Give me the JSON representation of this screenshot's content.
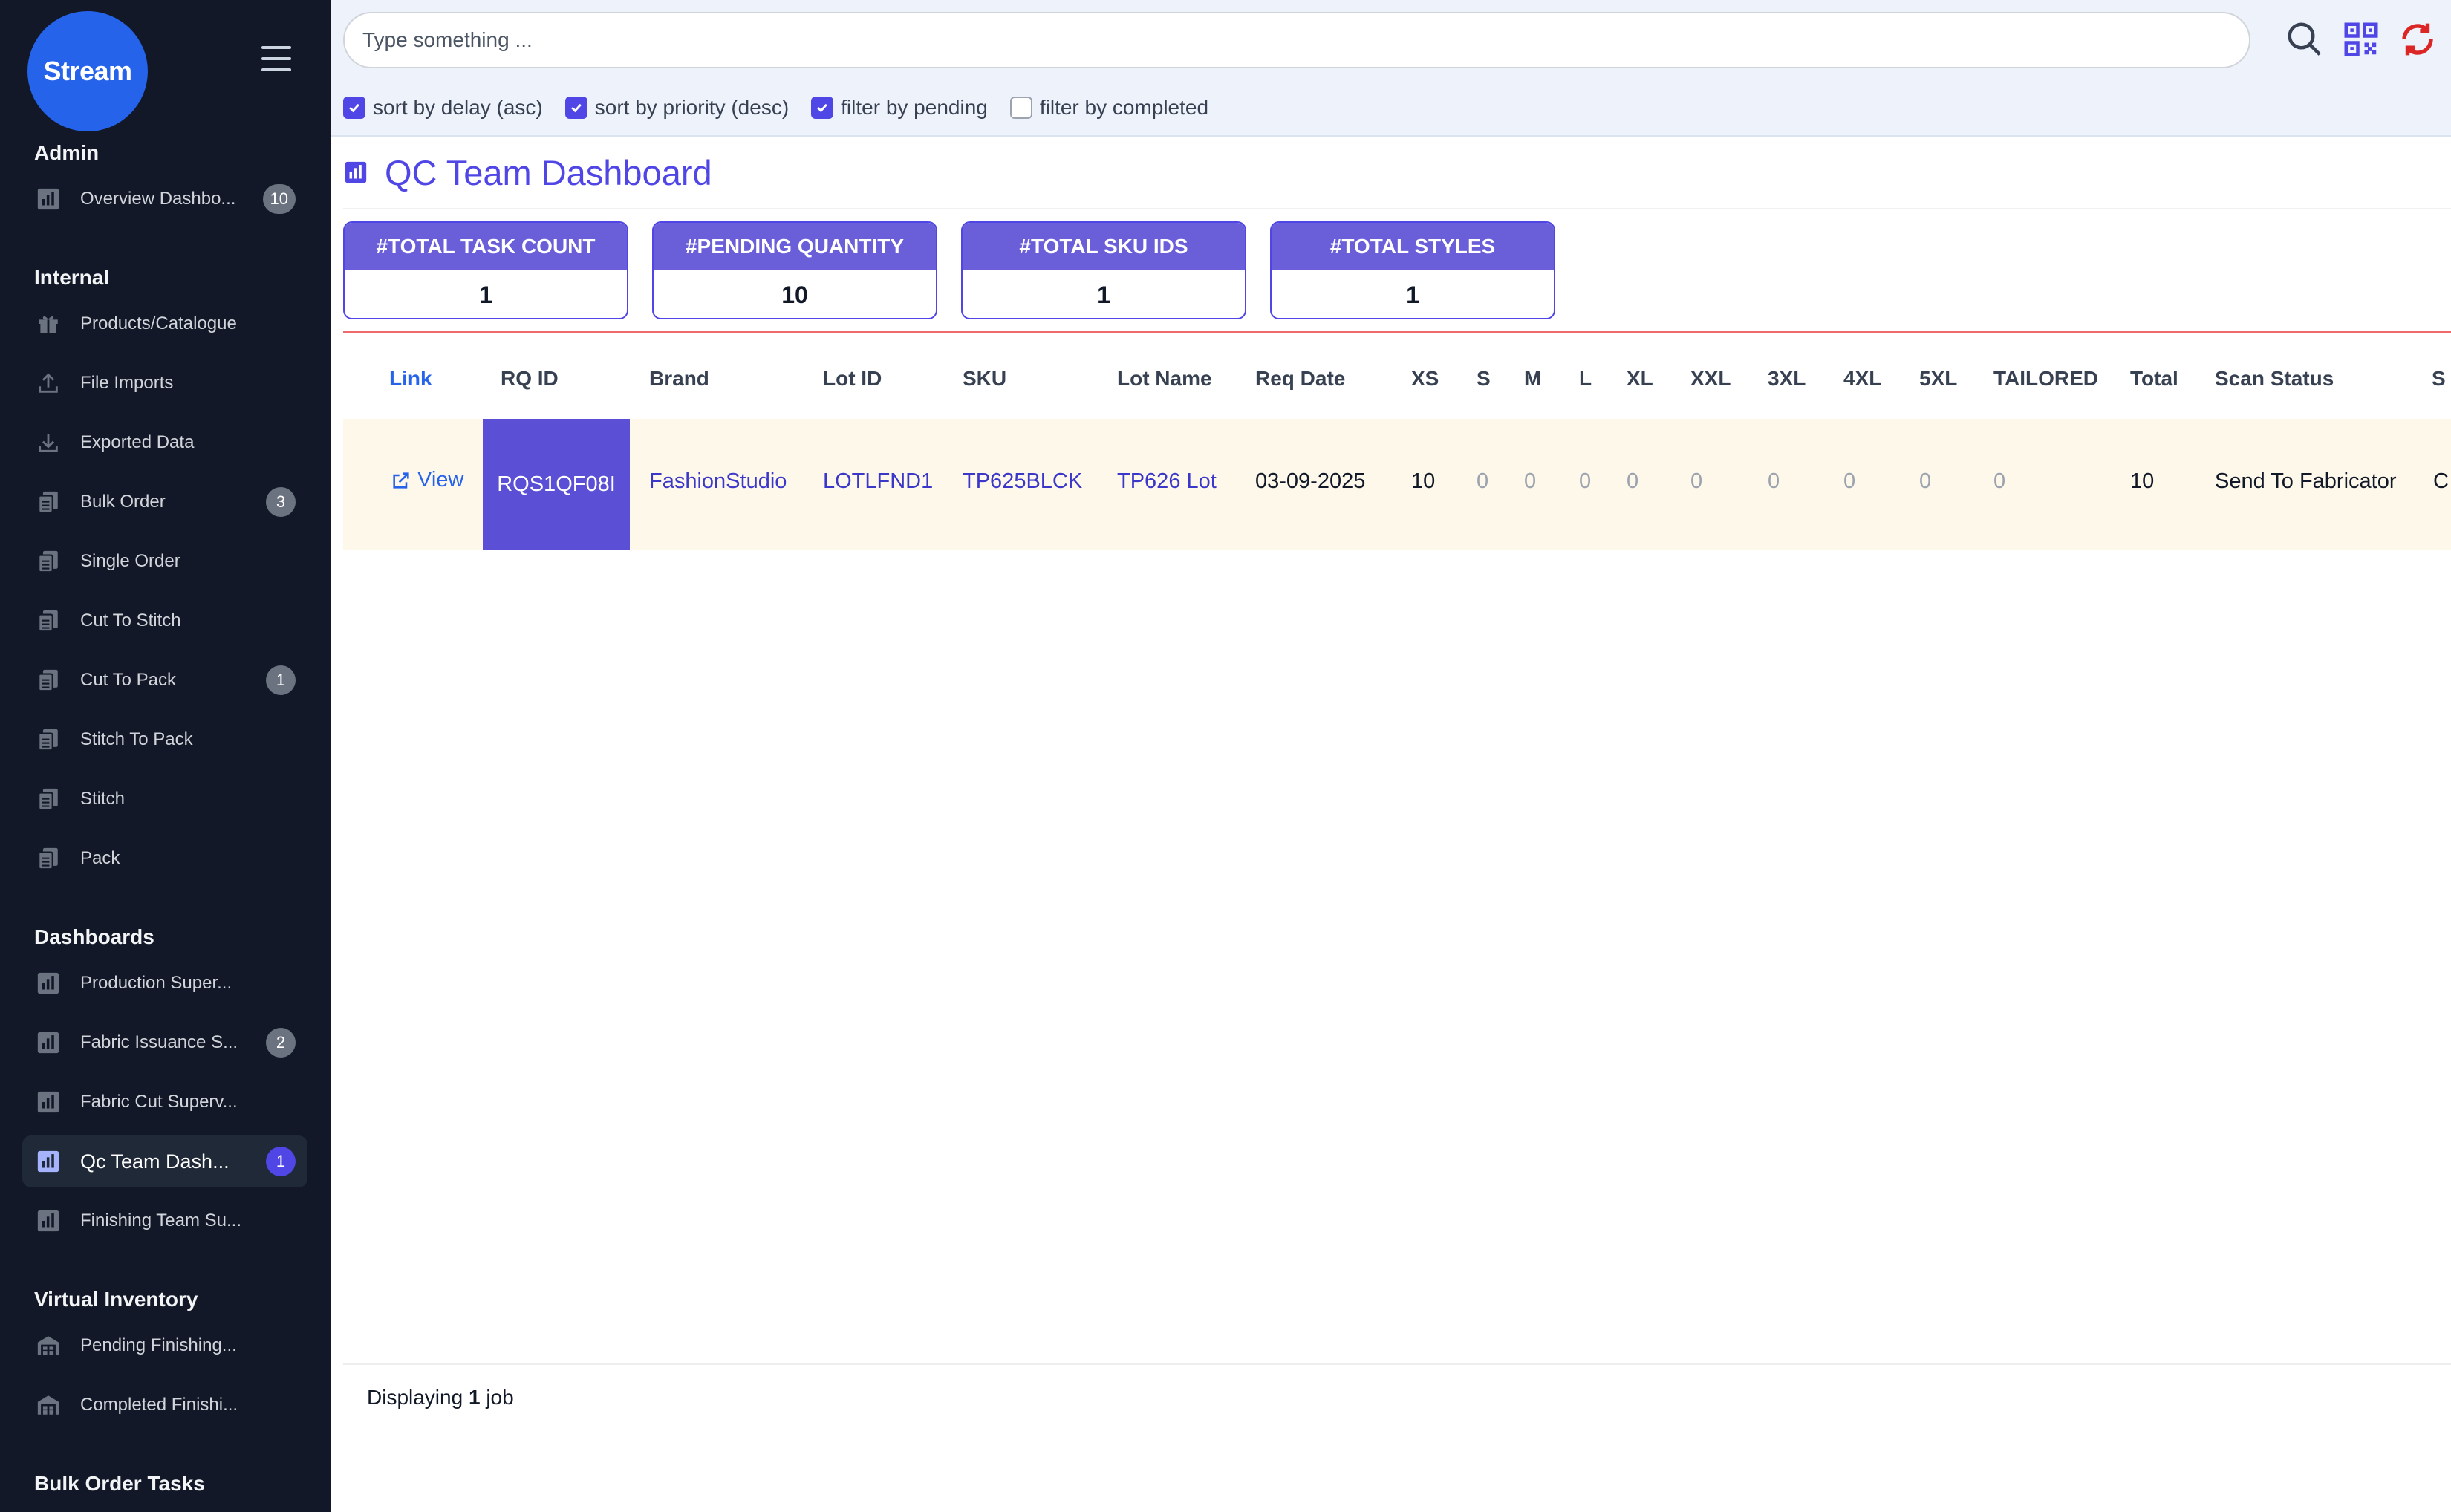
{
  "brand": {
    "logo_text": "Stream"
  },
  "sidebar": {
    "sections": {
      "admin": "Admin",
      "internal": "Internal",
      "dashboards": "Dashboards",
      "virtual_inventory": "Virtual Inventory",
      "bulk_order_tasks": "Bulk Order Tasks"
    },
    "admin_items": [
      {
        "label": "Overview Dashbo...",
        "badge": "10",
        "icon": "chart-icon"
      }
    ],
    "internal_items": [
      {
        "label": "Products/Catalogue",
        "icon": "gift-icon"
      },
      {
        "label": "File Imports",
        "icon": "upload-icon"
      },
      {
        "label": "Exported Data",
        "icon": "download-icon"
      },
      {
        "label": "Bulk Order",
        "badge": "3",
        "icon": "documents-icon"
      },
      {
        "label": "Single Order",
        "icon": "documents-icon"
      },
      {
        "label": "Cut To Stitch",
        "icon": "documents-icon"
      },
      {
        "label": "Cut To Pack",
        "badge": "1",
        "icon": "documents-icon"
      },
      {
        "label": "Stitch To Pack",
        "icon": "documents-icon"
      },
      {
        "label": "Stitch",
        "icon": "documents-icon"
      },
      {
        "label": "Pack",
        "icon": "documents-icon"
      }
    ],
    "dashboard_items": [
      {
        "label": "Production Super...",
        "icon": "chart-icon"
      },
      {
        "label": "Fabric Issuance S...",
        "badge": "2",
        "icon": "chart-icon"
      },
      {
        "label": "Fabric Cut Superv...",
        "icon": "chart-icon"
      },
      {
        "label": "Qc Team Dash...",
        "badge": "1",
        "active": true,
        "icon": "chart-icon"
      },
      {
        "label": "Finishing Team Su...",
        "icon": "chart-icon"
      }
    ],
    "virtual_inventory_items": [
      {
        "label": "Pending Finishing...",
        "icon": "warehouse-icon"
      },
      {
        "label": "Completed Finishi...",
        "icon": "warehouse-icon"
      }
    ]
  },
  "search": {
    "placeholder": "Type something ..."
  },
  "top_icons": [
    "search-icon",
    "qr-code-icon",
    "refresh-icon"
  ],
  "filters": [
    {
      "label": "sort by delay (asc)",
      "checked": true
    },
    {
      "label": "sort by priority (desc)",
      "checked": true
    },
    {
      "label": "filter by pending",
      "checked": true
    },
    {
      "label": "filter by completed",
      "checked": false
    }
  ],
  "page": {
    "title": "QC Team Dashboard"
  },
  "stats": [
    {
      "label": "#TOTAL TASK COUNT",
      "value": "1"
    },
    {
      "label": "#PENDING QUANTITY",
      "value": "10"
    },
    {
      "label": "#TOTAL SKU IDS",
      "value": "1"
    },
    {
      "label": "#TOTAL STYLES",
      "value": "1"
    }
  ],
  "table": {
    "headers": [
      "Link",
      "RQ ID",
      "Brand",
      "Lot ID",
      "SKU",
      "Lot Name",
      "Req Date",
      "XS",
      "S",
      "M",
      "L",
      "XL",
      "XXL",
      "3XL",
      "4XL",
      "5XL",
      "TAILORED",
      "Total",
      "Scan Status",
      "S"
    ],
    "rows": [
      {
        "link": "View",
        "rq_id": "RQS1QF08I",
        "brand": "FashionStudio",
        "lot_id": "LOTLFND1",
        "sku": "TP625BLCK",
        "lot_name": "TP626 Lot",
        "req_date": "03-09-2025",
        "xs": "10",
        "s": "0",
        "m": "0",
        "l": "0",
        "xl": "0",
        "xxl": "0",
        "x3": "0",
        "x4": "0",
        "x5": "0",
        "tailored": "0",
        "total": "10",
        "scan_status": "Send To Fabricator",
        "overflow": "C"
      }
    ]
  },
  "footer": {
    "prefix": "Displaying",
    "count": "1",
    "suffix": "job"
  },
  "colors": {
    "accent": "#4f46e5",
    "sidebar_bg": "#121827",
    "stat_header": "#6b5fd9",
    "row_bg": "#fdf8ea",
    "divider_red": "#ef6b6b"
  }
}
